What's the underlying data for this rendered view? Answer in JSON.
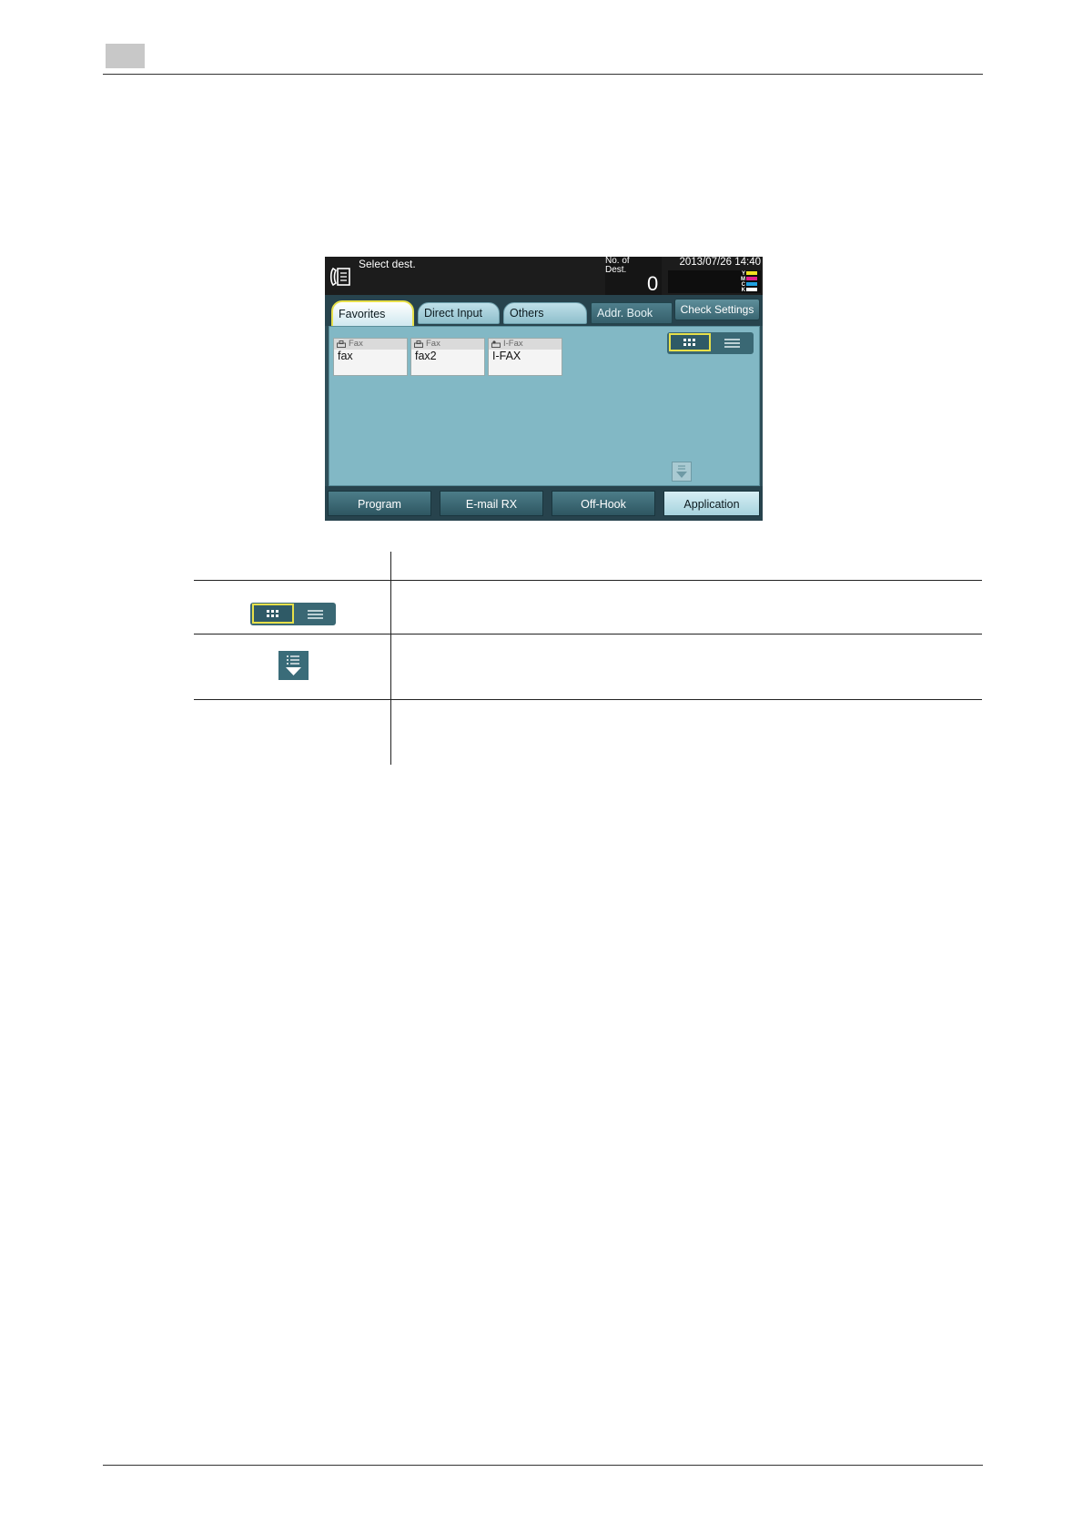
{
  "panel": {
    "title": "Select dest.",
    "dest_label": "No. of Dest.",
    "dest_count": "0",
    "datetime": "2013/07/26 14:40",
    "ink_labels": [
      "Y",
      "M",
      "C",
      "K"
    ],
    "ink_colors": [
      "#f0e020",
      "#e0208c",
      "#20a0e0",
      "#ffffff"
    ],
    "tabs": {
      "favorites": "Favorites",
      "direct_input": "Direct Input",
      "others": "Others",
      "addr_book": "Addr. Book"
    },
    "check_settings": "Check Settings",
    "destinations": [
      {
        "type": "Fax",
        "name": "fax"
      },
      {
        "type": "Fax",
        "name": "fax2"
      },
      {
        "type": "I-Fax",
        "name": "I-FAX"
      }
    ],
    "bottom_buttons": {
      "program": "Program",
      "email_rx": "E-mail RX",
      "off_hook": "Off-Hook",
      "application": "Application"
    }
  },
  "colors": {
    "highlight": "#e7e04a",
    "panel_bg": "#82b8c5",
    "panel_dark": "#27434d"
  }
}
